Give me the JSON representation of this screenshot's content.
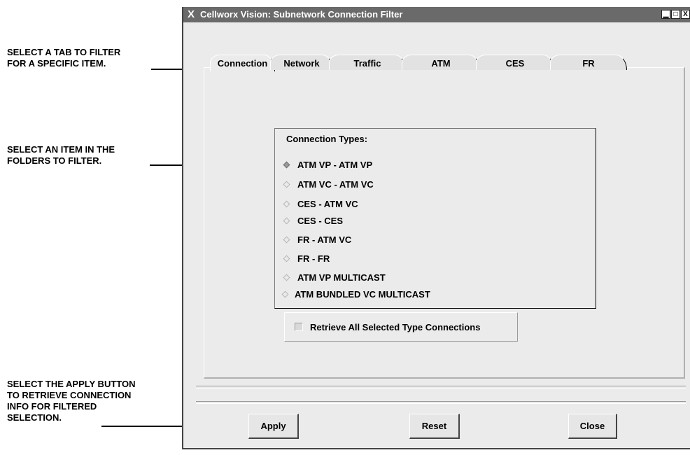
{
  "annotations": [
    "SELECT A TAB TO FILTER\nFOR A SPECIFIC ITEM.",
    "SELECT AN ITEM IN THE\nFOLDERS TO FILTER.",
    "SELECT THE APPLY BUTTON\nTO RETRIEVE CONNECTION\nINFO FOR FILTERED\nSELECTION."
  ],
  "window": {
    "title": "Cellworx Vision: Subnetwork Connection Filter",
    "title_icon": "x-logo-icon",
    "controls": [
      "minimize-icon",
      "maximize-icon",
      "close-icon"
    ]
  },
  "tabs": [
    {
      "label": "Connection",
      "active": true
    },
    {
      "label": "Network",
      "active": false
    },
    {
      "label": "Traffic",
      "active": false
    },
    {
      "label": "ATM",
      "active": false
    },
    {
      "label": "CES",
      "active": false
    },
    {
      "label": "FR",
      "active": false
    }
  ],
  "connection_types": {
    "title": "Connection Types:",
    "options": [
      {
        "label": "ATM VP - ATM VP",
        "selected": true
      },
      {
        "label": "ATM VC - ATM VC",
        "selected": false
      },
      {
        "label": "CES - ATM VC",
        "selected": false
      },
      {
        "label": "CES - CES",
        "selected": false
      },
      {
        "label": "FR - ATM VC",
        "selected": false
      },
      {
        "label": "FR - FR",
        "selected": false
      },
      {
        "label": "ATM VP MULTICAST",
        "selected": false
      },
      {
        "label": "ATM BUNDLED VC MULTICAST",
        "selected": false
      }
    ]
  },
  "retrieve_all": {
    "label": "Retrieve All Selected Type Connections",
    "checked": false
  },
  "buttons": {
    "apply": "Apply",
    "reset": "Reset",
    "close": "Close"
  },
  "colors": {
    "titlebar": "#6a6a6a",
    "window_bg": "#ebebeb",
    "selected_radio": "#9a9a9a"
  }
}
